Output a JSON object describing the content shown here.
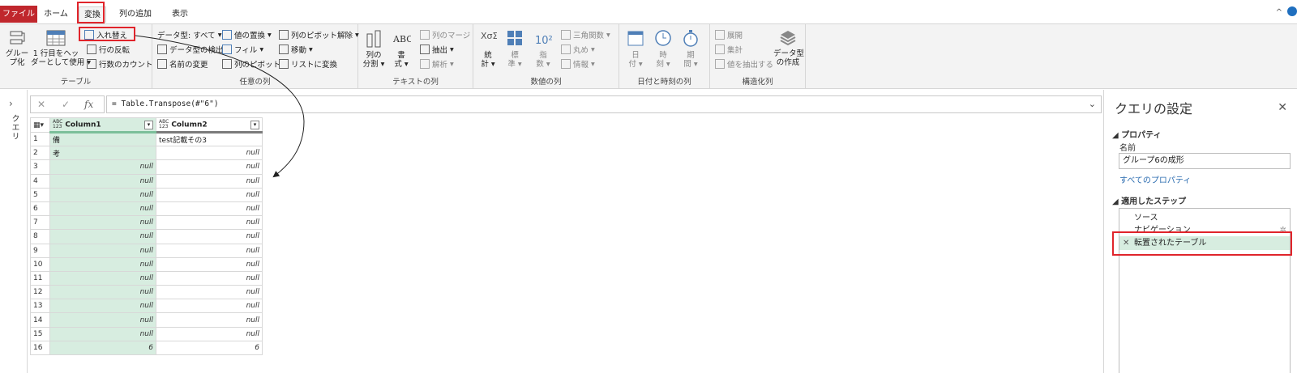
{
  "tabs": [
    {
      "label": "ファイル"
    },
    {
      "label": "ホーム"
    },
    {
      "label": "変換"
    },
    {
      "label": "列の追加"
    },
    {
      "label": "表示"
    }
  ],
  "ribbon": {
    "table_group": {
      "label": "テーブル",
      "group_by": "グルー\nプ化",
      "use_first_row": "1 行目をヘッ\nダーとして使用",
      "transpose": "入れ替え",
      "reverse_rows": "行の反転",
      "count_rows": "行数のカウント"
    },
    "any_column_group": {
      "label": "任意の列",
      "data_type": "データ型: すべて",
      "detect_type": "データ型の検出",
      "rename": "名前の変更",
      "replace_values": "値の置換",
      "fill": "フィル",
      "pivot": "列のピボット",
      "unpivot": "列のピボット解除",
      "move": "移動",
      "to_list": "リストに変換"
    },
    "text_group": {
      "label": "テキストの列",
      "split": "列の\n分割",
      "format": "書\n式",
      "merge": "列のマージ",
      "extract": "抽出",
      "parse": "解析"
    },
    "number_group": {
      "label": "数値の列",
      "stats": "統\n計",
      "standard": "標\n準",
      "scientific": "指\n数",
      "trig": "三角関数",
      "rounding": "丸め",
      "info": "情報"
    },
    "datetime_group": {
      "label": "日付と時刻の列",
      "date": "日\n付",
      "time": "時\n刻",
      "duration": "期\n間"
    },
    "structured_group": {
      "label": "構造化列",
      "expand": "展開",
      "aggregate": "集計",
      "extract_values": "値を抽出する",
      "create_type": "データ型\nの作成"
    }
  },
  "left_pane": {
    "label": "クエリ"
  },
  "formula": {
    "text": "= Table.Transpose(#\"6\")",
    "fx": "fx"
  },
  "grid": {
    "headers": [
      {
        "type": "ABC\n123",
        "name": "Column1"
      },
      {
        "type": "ABC\n123",
        "name": "Column2"
      }
    ],
    "rows": [
      {
        "n": "1",
        "c1": "備",
        "c2": "test記載その3"
      },
      {
        "n": "2",
        "c1": "考",
        "c2": "null"
      },
      {
        "n": "3",
        "c1": "null",
        "c2": "null"
      },
      {
        "n": "4",
        "c1": "null",
        "c2": "null"
      },
      {
        "n": "5",
        "c1": "null",
        "c2": "null"
      },
      {
        "n": "6",
        "c1": "null",
        "c2": "null"
      },
      {
        "n": "7",
        "c1": "null",
        "c2": "null"
      },
      {
        "n": "8",
        "c1": "null",
        "c2": "null"
      },
      {
        "n": "9",
        "c1": "null",
        "c2": "null"
      },
      {
        "n": "10",
        "c1": "null",
        "c2": "null"
      },
      {
        "n": "11",
        "c1": "null",
        "c2": "null"
      },
      {
        "n": "12",
        "c1": "null",
        "c2": "null"
      },
      {
        "n": "13",
        "c1": "null",
        "c2": "null"
      },
      {
        "n": "14",
        "c1": "null",
        "c2": "null"
      },
      {
        "n": "15",
        "c1": "null",
        "c2": "null"
      },
      {
        "n": "16",
        "c1": "6",
        "c2": "6"
      }
    ]
  },
  "settings": {
    "title": "クエリの設定",
    "properties_label": "プロパティ",
    "name_label": "名前",
    "name_value": "グループ6の成形",
    "all_props": "すべてのプロパティ",
    "steps_label": "適用したステップ",
    "steps": [
      {
        "label": "ソース"
      },
      {
        "label": "ナビゲーション"
      },
      {
        "label": "転置されたテーブル"
      }
    ]
  },
  "colors": {
    "file_tab": "#c0272d",
    "highlight": "#e0242b",
    "selected": "#d7ede0"
  }
}
